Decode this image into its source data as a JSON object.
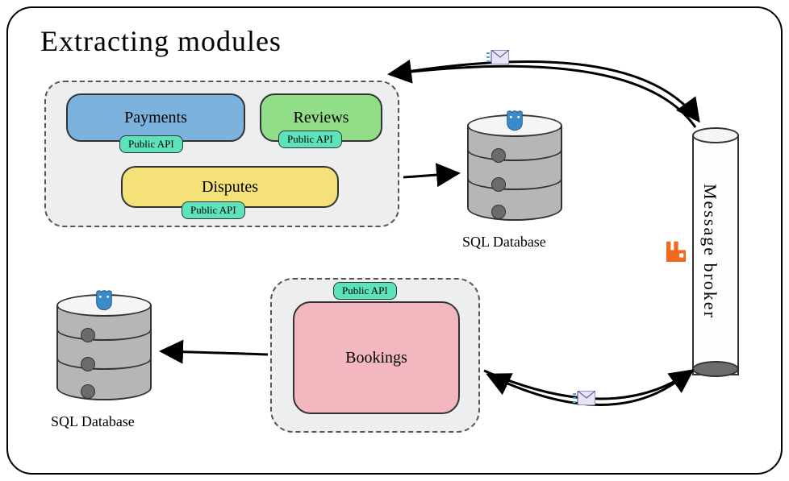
{
  "title": "Extracting modules",
  "modules": {
    "payments": {
      "label": "Payments",
      "api": "Public API"
    },
    "reviews": {
      "label": "Reviews",
      "api": "Public API"
    },
    "disputes": {
      "label": "Disputes",
      "api": "Public API"
    },
    "bookings": {
      "label": "Bookings",
      "api": "Public API"
    }
  },
  "databases": {
    "db1": {
      "label": "SQL Database"
    },
    "db2": {
      "label": "SQL Database"
    }
  },
  "broker": {
    "label": "Message broker"
  },
  "icons": {
    "postgres": "postgres-elephant",
    "rabbitmq": "rabbitmq",
    "envelope": "envelope"
  },
  "colors": {
    "payments": "#7bb3de",
    "reviews": "#92dd87",
    "disputes": "#f5e17a",
    "bookings": "#f3b8bf",
    "api": "#5de3b9",
    "db_body": "#b5b6b8",
    "rabbit": "#f26b1d"
  }
}
